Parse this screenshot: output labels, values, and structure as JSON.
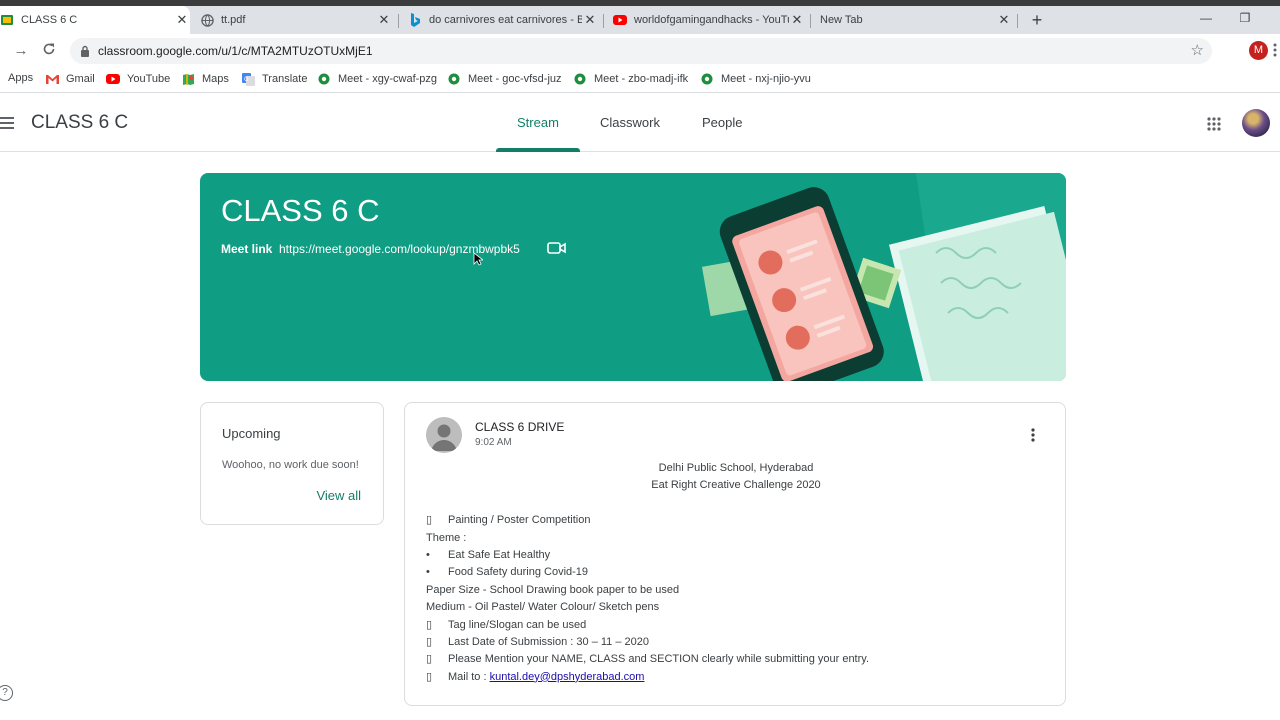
{
  "browser": {
    "tabs": [
      {
        "title": "CLASS 6 C",
        "icon": "classroom-icon",
        "active": true
      },
      {
        "title": "tt.pdf",
        "icon": "globe-icon"
      },
      {
        "title": "do carnivores eat carnivores - Bin",
        "icon": "bing-icon"
      },
      {
        "title": "worldofgamingandhacks - YouTu",
        "icon": "youtube-icon"
      },
      {
        "title": "New Tab",
        "icon": ""
      }
    ],
    "new_tab": "+",
    "window_controls": {
      "minimize": "—",
      "restore": "❐"
    },
    "url": "classroom.google.com/u/1/c/MTA2MTUzOTUxMjE1",
    "profile_initial": "M",
    "bookmarks": [
      {
        "label": "Apps",
        "icon": "apps-grid-icon"
      },
      {
        "label": "Gmail",
        "icon": "gmail-icon"
      },
      {
        "label": "YouTube",
        "icon": "youtube-icon"
      },
      {
        "label": "Maps",
        "icon": "maps-icon"
      },
      {
        "label": "Translate",
        "icon": "translate-icon"
      },
      {
        "label": "Meet - xgy-cwaf-pzg",
        "icon": "meet-icon"
      },
      {
        "label": "Meet - goc-vfsd-juz",
        "icon": "meet-icon"
      },
      {
        "label": "Meet - zbo-madj-ifk",
        "icon": "meet-icon"
      },
      {
        "label": "Meet - nxj-njio-yvu",
        "icon": "meet-icon"
      }
    ]
  },
  "classroom": {
    "class_name": "CLASS 6 C",
    "tabs": [
      {
        "label": "Stream",
        "active": true
      },
      {
        "label": "Classwork"
      },
      {
        "label": "People"
      }
    ],
    "accent_color": "#137e67",
    "banner": {
      "title": "CLASS 6 C",
      "meet_label": "Meet link",
      "meet_url": "https://meet.google.com/lookup/gnzmbwpbk5",
      "color": "#0f9d83"
    },
    "upcoming": {
      "title": "Upcoming",
      "empty_text": "Woohoo, no work due soon!",
      "view_all": "View all"
    },
    "post": {
      "author": "CLASS 6 DRIVE",
      "time": "9:02 AM",
      "header_lines": [
        "Delhi Public School, Hyderabad",
        "Eat Right Creative Challenge 2020"
      ],
      "lines": [
        {
          "bullet": "",
          "text": "Painting / Poster Competition"
        },
        {
          "bullet": "",
          "text": "Theme :"
        },
        {
          "bullet": "•",
          "text": "Eat Safe Eat Healthy"
        },
        {
          "bullet": "•",
          "text": "Food Safety during Covid-19"
        },
        {
          "bullet": "",
          "text": "Paper Size - School Drawing book paper to be used"
        },
        {
          "bullet": "",
          "text": "Medium - Oil Pastel/ Water Colour/ Sketch pens"
        },
        {
          "bullet": "",
          "text": "Tag line/Slogan can be used"
        },
        {
          "bullet": "",
          "text": "Last Date of Submission : 30 – 11 – 2020"
        },
        {
          "bullet": "",
          "text": "Please Mention your NAME, CLASS and SECTION clearly while submitting your entry."
        }
      ],
      "mail_label": "Mail to : ",
      "mail_link": "kuntal.dey@dpshyderabad.com"
    }
  }
}
